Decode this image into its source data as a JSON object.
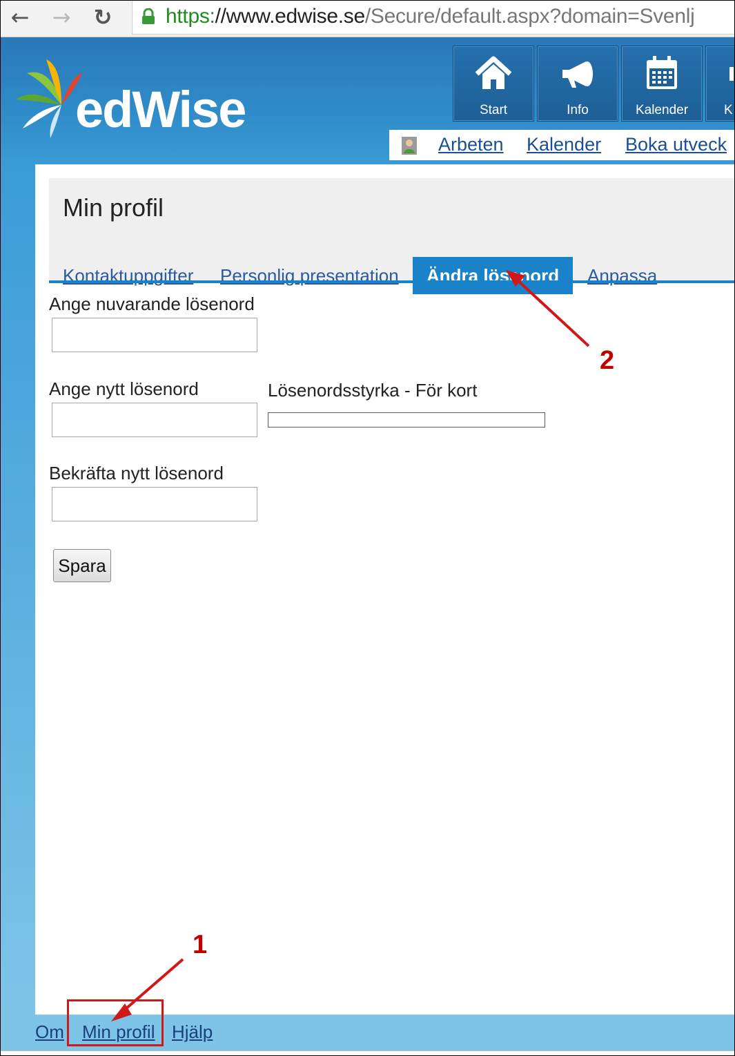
{
  "browser": {
    "url_scheme": "https:",
    "url_host": "//www.edwise.se",
    "url_path": "/Secure/default.aspx?domain=Svenlj"
  },
  "header": {
    "logo_text": "edWise",
    "tiles": [
      {
        "label": "Start",
        "icon": "home-icon"
      },
      {
        "label": "Info",
        "icon": "megaphone-icon"
      },
      {
        "label": "Kalender",
        "icon": "calendar-icon"
      },
      {
        "label": "K",
        "icon": "partial-icon"
      }
    ],
    "subnav": {
      "links": [
        "Arbeten",
        "Kalender",
        "Boka utveck"
      ]
    }
  },
  "page": {
    "title": "Min profil",
    "tabs": [
      {
        "label": "Kontaktuppgifter",
        "active": false
      },
      {
        "label": "Personlig presentation",
        "active": false
      },
      {
        "label": "Ändra lösenord",
        "active": true
      },
      {
        "label": "Anpassa",
        "active": false
      }
    ],
    "form": {
      "current_label": "Ange nuvarande lösenord",
      "current_value": "",
      "new_label": "Ange nytt lösenord",
      "new_value": "",
      "strength_label": "Lösenordsstyrka - För kort",
      "strength_fraction": 0,
      "confirm_label": "Bekräfta nytt lösenord",
      "confirm_value": "",
      "save_label": "Spara"
    }
  },
  "footer": {
    "links": [
      "Om",
      "Min profil",
      "Hjälp"
    ]
  },
  "annotations": {
    "marker_1": "1",
    "marker_2": "2"
  },
  "colors": {
    "header_blue": "#2f8cc9",
    "tab_active": "#1a82c8",
    "annotation_red": "#c00000"
  }
}
